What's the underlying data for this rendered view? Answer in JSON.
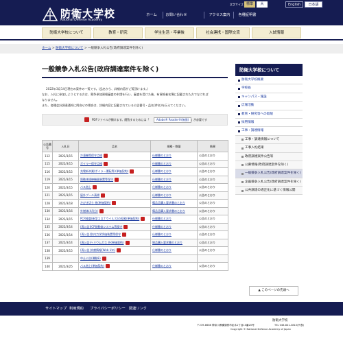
{
  "header": {
    "logo_name": "防衛大学校",
    "logo_en": "National Defense Academy",
    "font_size_label": "文字サイズ",
    "font_size_standard": "標準",
    "font_size_large": "大",
    "lang_en": "English",
    "lang_ja": "日本語",
    "util_links": [
      "ホーム",
      "お問い合わせ",
      "アクセス案内",
      "各種証明書"
    ]
  },
  "global_nav": [
    "防衛大学校について",
    "教育・研究",
    "学生生活・卒業後",
    "社会連携・国際交流",
    "入試情報"
  ],
  "breadcrumb": {
    "home": "ホーム",
    "about": "防衛大学校について",
    "current": "一般競争入札公告(政府調達案件を除く)",
    "sep": ">"
  },
  "main": {
    "title": "一般競争入札公告(政府調達案件を除く)",
    "intro_lines": [
      "2022年3月14日現在の案件の一覧です。(品名から、詳細内容がご覧頂けます。)",
      "なお、入札に参加しようとする方は、競争参加資格審査の申請を行い、審査を受けた後、有資格者名簿に記載された方でなければ",
      "なりません。",
      "また、各種会計調達通知に問合せの場合は、詳細内容に記載されている公告番号・品名(件名)を伝えてください。"
    ],
    "pdf_note": "PDFファイルが開けます。閲覧するためには「",
    "reader_label": "Adobe® Reader®(無償)",
    "pdf_note_tail": "」が必要です",
    "table": {
      "headers": [
        "公告番号",
        "入札日",
        "品名",
        "規格・数量",
        "結果"
      ],
      "rows": [
        {
          "no": "112",
          "date": "2022/3/15",
          "item": "冷凍機等保守点検",
          "spec": "仕様書のとおり",
          "result": "公告のとおり"
        },
        {
          "no": "115",
          "date": "2022/3/15",
          "item": "ボイラー保守点検",
          "spec": "仕様書のとおり",
          "result": "公告のとおり"
        },
        {
          "no": "116",
          "date": "2022/3/15",
          "item": "充電新卒業(ボイラー運転等)(単価契約)",
          "spec": "仕様書のとおり",
          "result": "公告のとおり"
        },
        {
          "no": "119",
          "date": "2022/3/15",
          "item": "照動体操練機器装置等保守",
          "spec": "仕様書のとおり",
          "result": "公告のとおり"
        },
        {
          "no": "120",
          "date": "2022/3/15",
          "item": "バス借上",
          "spec": "仕様書のとおり",
          "result": "公告のとおり"
        },
        {
          "no": "121",
          "date": "2022/3/15",
          "item": "屋外プール清掃",
          "spec": "仕様書のとおり",
          "result": "公告のとおり"
        },
        {
          "no": "128",
          "date": "2022/3/18",
          "item": "かびき切り 他(単価契約)",
          "spec": "備品品購入要求書のとおり",
          "result": "公告のとおり"
        },
        {
          "no": "130",
          "date": "2022/3/16",
          "item": "外燃体(4月分)",
          "spec": "備品品購入要求書のとおり",
          "result": "公告のとおり"
        },
        {
          "no": "134",
          "date": "2022/3/15",
          "item": "PCR検査(新型コロナウイルス)の役務(単価契約)",
          "spec": "仕様書のとおり",
          "result": "公告のとおり"
        },
        {
          "no": "135",
          "date": "2022/3/14",
          "item": "(再公告)ICP発動体システム等保守",
          "spec": "仕様書のとおり",
          "result": "公告のとおり"
        },
        {
          "no": "136",
          "date": "2022/3/14",
          "item": "(再公告)別内力学評価装置等保守",
          "spec": "仕様書のとおり",
          "result": "公告のとおり"
        },
        {
          "no": "137",
          "date": "2022/3/14",
          "item": "(再公告)ヘリウムガス 外(単価契約)",
          "spec": "物品購入要求書のとおり",
          "result": "公告のとおり"
        },
        {
          "no": "138",
          "date": "2022/3/15",
          "item": "(再公告)文献情報(Web Um)",
          "spec": "仕様書のとおり",
          "result": "公告のとおり"
        },
        {
          "no": "139",
          "date": "",
          "item": "中止公告(運動E)",
          "spec": "",
          "result": ""
        },
        {
          "no": "140",
          "date": "2022/3/25",
          "item": "バス借上(単価契約)",
          "spec": "仕様書のとおり",
          "result": "公告のとおり"
        }
      ]
    },
    "pagetop": "このページの先頭へ"
  },
  "sidebar": {
    "heading": "防衛大学校について",
    "items": [
      {
        "label": "防衛大学校概要",
        "level": "top"
      },
      {
        "label": "学校長",
        "level": "top"
      },
      {
        "label": "キャンパス・施設",
        "level": "top"
      },
      {
        "label": "広報活動",
        "level": "top"
      },
      {
        "label": "教育・研究等への取組",
        "level": "top"
      },
      {
        "label": "採用情報",
        "level": "top"
      },
      {
        "label": "工事・調達情報",
        "level": "top"
      },
      {
        "label": "工事・調達情報について",
        "level": "sub"
      },
      {
        "label": "工事入札結果",
        "level": "sub"
      },
      {
        "label": "政府調達案件公告等",
        "level": "sub"
      },
      {
        "label": "公募情報(政府調達案件を除く)",
        "level": "sub"
      },
      {
        "label": "一般競争入札公告(政府調達案件を除く)",
        "level": "active"
      },
      {
        "label": "企画競争入札公告(政府調達案件を除く)",
        "level": "sub"
      },
      {
        "label": "公共調達の適正化に基づく情報公開",
        "level": "sub"
      }
    ]
  },
  "footer": {
    "nav": [
      "サイトマップ",
      "利用規約",
      "プライバシーポリシー",
      "関連リンク"
    ],
    "name": "防衛大学校",
    "address": "〒239-8686 神奈川県横須賀市走水1丁目10番20号",
    "tel": "TEL 046-841-3810(代表)",
    "copyright": "Copyright © National Defense Academy of Japan"
  },
  "colors": {
    "navy": "#151c52",
    "beige": "#f3edd2",
    "link": "#1a3aa0",
    "pdf_red": "#c62020"
  }
}
